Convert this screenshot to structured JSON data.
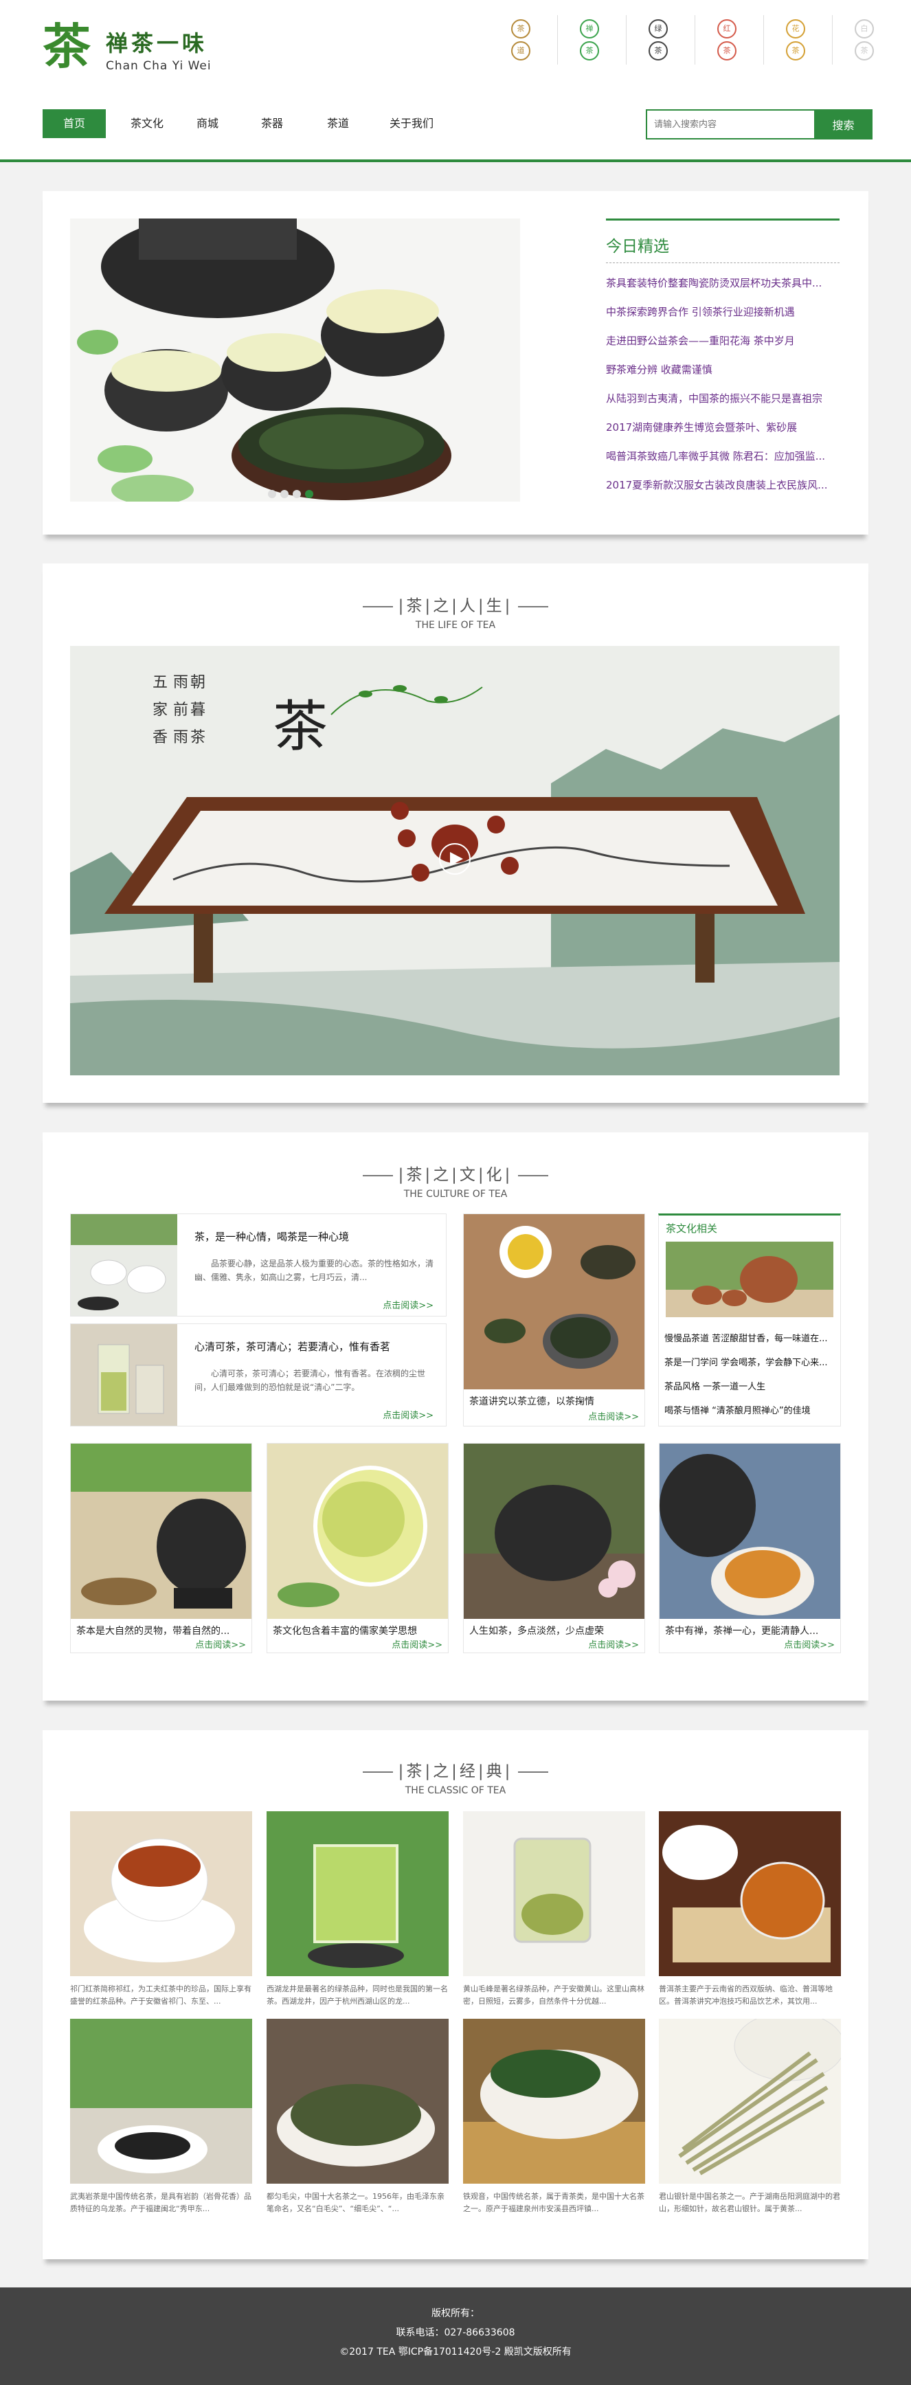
{
  "brand": {
    "logo_char": "茶",
    "logo_cn": "禅茶一味",
    "logo_en": "Chan Cha Yi Wei"
  },
  "seals": [
    {
      "text": [
        "茶",
        "道"
      ],
      "color": "#b58a3a"
    },
    {
      "text": [
        "禅",
        "茶"
      ],
      "color": "#3aa34b"
    },
    {
      "text": [
        "绿",
        "茶"
      ],
      "color": "#444444"
    },
    {
      "text": [
        "红",
        "茶"
      ],
      "color": "#d45a4a"
    },
    {
      "text": [
        "花",
        "茶"
      ],
      "color": "#d4a034"
    },
    {
      "text": [
        "白",
        "茶"
      ],
      "color": "#cccccc"
    }
  ],
  "nav": {
    "items": [
      {
        "label": "首页"
      },
      {
        "label": "茶文化"
      },
      {
        "label": "商城"
      },
      {
        "label": "茶器"
      },
      {
        "label": "茶道"
      },
      {
        "label": "关于我们"
      }
    ]
  },
  "search": {
    "placeholder": "请输入搜索内容",
    "button": "搜索"
  },
  "today": {
    "title": "今日精选",
    "items": [
      "茶具套装特价整套陶瓷防烫双层杯功夫茶具中...",
      "中茶探索跨界合作 引领茶行业迎接新机遇",
      "走进田野公益茶会——重阳花海 茶中岁月",
      "野茶难分辨 收藏需谨慎",
      "从陆羽到古夷清，中国茶的振兴不能只是喜祖宗",
      "2017湖南健康养生博览会暨茶叶、紫砂展",
      "喝普洱茶致癌几率微乎其微 陈君石：应加强监...",
      "2017夏季新款汉服女古装改良唐装上衣民族风..."
    ]
  },
  "life": {
    "title_chars": [
      "茶",
      "之",
      "人",
      "生"
    ],
    "subtitle": "THE LIFE OF TEA",
    "painting_char": "茶"
  },
  "culture": {
    "title_chars": [
      "茶",
      "之",
      "文",
      "化"
    ],
    "subtitle": "THE CULTURE OF TEA",
    "featured": [
      {
        "title": "茶，是一种心情，喝茶是一种心境",
        "text": "品茶要心静，这是品茶人极为重要的心态。茶的性格如水，清幽、儒雅、隽永，如高山之雾，七月巧云，清...",
        "more": "点击阅读>>"
      },
      {
        "title": "心清可茶，茶可清心；若要清心，惟有香茗",
        "text": "心清可茶，茶可清心；若要清心，惟有香茗。在浓稠的尘世间，人们最难做到的恐怕就是说“清心”二字。",
        "more": "点击阅读>>"
      }
    ],
    "middle": {
      "caption": "茶道讲究以茶立德，以茶掬情",
      "more": "点击阅读>>"
    },
    "related": {
      "title": "茶文化相关",
      "items": [
        "慢慢品茶道 苦涩酿甜甘香，每一味道在...",
        "茶是一门学问 学会喝茶，学会静下心来...",
        "茶品风格 一茶一道一人生",
        "喝茶与悟禅 “清茶酿月照禅心”的佳境"
      ]
    },
    "cards": [
      {
        "caption": "茶本是大自然的灵物，带着自然的...",
        "more": "点击阅读>>"
      },
      {
        "caption": "茶文化包含着丰富的儒家美学思想",
        "more": "点击阅读>>"
      },
      {
        "caption": "人生如茶，多点淡然，少点虚荣",
        "more": "点击阅读>>"
      },
      {
        "caption": "茶中有禅，茶禅一心，更能清静人...",
        "more": "点击阅读>>"
      }
    ]
  },
  "classic": {
    "title_chars": [
      "茶",
      "之",
      "经",
      "典"
    ],
    "subtitle": "THE CLASSIC OF TEA",
    "items": [
      {
        "text": "祁门红茶简称祁红，为工夫红茶中的珍品，国际上享有盛誉的红茶品种。产于安徽省祁门、东至、..."
      },
      {
        "text": "西湖龙井是最著名的绿茶品种，同时也是我国的第一名茶。西湖龙井，因产于杭州西湖山区的龙..."
      },
      {
        "text": "黄山毛峰是著名绿茶品种，产于安徽黄山。这里山高林密，日照短，云雾多，自然条件十分优越..."
      },
      {
        "text": "普洱茶主要产于云南省的西双版纳、临沧、普洱等地区。普洱茶讲究冲泡技巧和品饮艺术，其饮用..."
      },
      {
        "text": "武夷岩茶是中国传统名茶，是具有岩韵（岩骨花香）品质特征的乌龙茶。产于福建闽北“秀甲东..."
      },
      {
        "text": "都匀毛尖，中国十大名茶之一。1956年，由毛泽东亲笔命名，又名“白毛尖”、“细毛尖”、“..."
      },
      {
        "text": "铁观音，中国传统名茶，属于青茶类，是中国十大名茶之一。原产于福建泉州市安溪县西坪镇..."
      },
      {
        "text": "君山银针是中国名茶之一。产于湖南岳阳洞庭湖中的君山，形细如针，故名君山银针。属于黄茶..."
      }
    ]
  },
  "footer": {
    "line1": "版权所有：",
    "line2": "联系电话：027-86633608",
    "line3": "©2017 TEA 鄂ICP备17011420号-2 殿凯文版权所有"
  }
}
